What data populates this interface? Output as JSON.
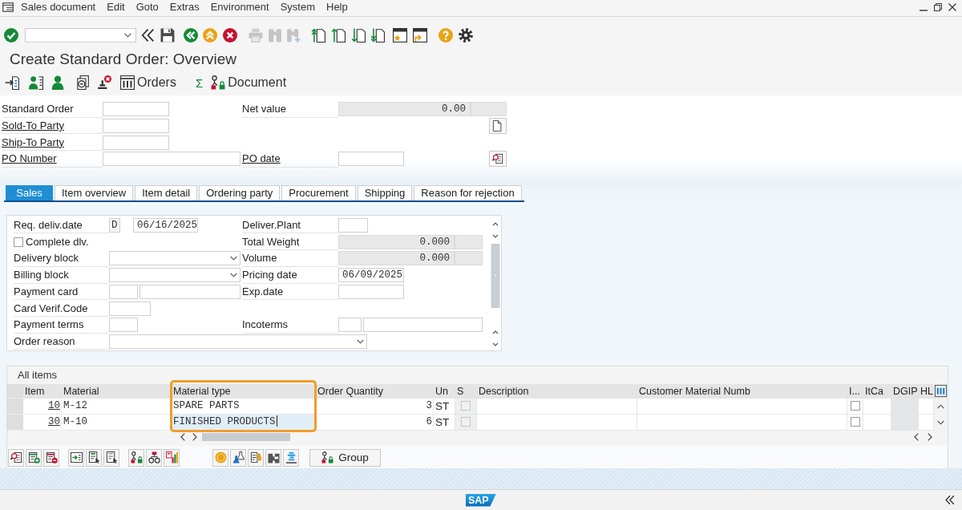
{
  "menu": [
    {
      "label": "Sales document"
    },
    {
      "label": "Edit"
    },
    {
      "label": "Goto"
    },
    {
      "label": "Extras"
    },
    {
      "label": "Environment"
    },
    {
      "label": "System"
    },
    {
      "label": "Help"
    }
  ],
  "title": "Create Standard Order: Overview",
  "app_toolbar": {
    "buttons": [
      {
        "label": "Orders"
      },
      {
        "label": "Σ"
      },
      {
        "label": "Document"
      }
    ]
  },
  "header": {
    "rows": [
      {
        "left": {
          "label": "Standard Order",
          "link": false,
          "fields": [
            {
              "kind": "input"
            }
          ]
        },
        "right": {
          "label": "Net value",
          "link": false,
          "fields": [
            {
              "kind": "display",
              "value": "0.00"
            },
            {
              "kind": "display"
            }
          ]
        }
      },
      {
        "left": {
          "label": "Sold-To Party",
          "link": true,
          "fields": [
            {
              "kind": "input"
            }
          ]
        }
      },
      {
        "left": {
          "label": "Ship-To Party",
          "link": true,
          "fields": [
            {
              "kind": "input"
            }
          ]
        }
      },
      {
        "left": {
          "label": "PO Number",
          "link": true,
          "fields": [
            {
              "kind": "input"
            }
          ]
        },
        "right": {
          "label": "PO date",
          "link": true,
          "fields": [
            {
              "kind": "input"
            }
          ]
        }
      }
    ]
  },
  "tabs": [
    {
      "label": "Sales",
      "selected": true
    },
    {
      "label": "Item overview",
      "selected": false
    },
    {
      "label": "Item detail",
      "selected": false
    },
    {
      "label": "Ordering party",
      "selected": false
    },
    {
      "label": "Procurement",
      "selected": false
    },
    {
      "label": "Shipping",
      "selected": false
    },
    {
      "label": "Reason for rejection",
      "selected": false
    }
  ],
  "sales": {
    "rows": [
      {
        "left": {
          "label": "Req. deliv.date",
          "fields": [
            {
              "kind": "input",
              "value": "D"
            },
            {
              "kind": "input",
              "value": "06/16/2025"
            }
          ]
        },
        "right": {
          "label": "Deliver.Plant",
          "fields": [
            {
              "kind": "input"
            }
          ]
        }
      },
      {
        "checkbox": {
          "label": "Complete dlv.",
          "checked": false
        },
        "right": {
          "label": "Total Weight",
          "fields": [
            {
              "kind": "display",
              "value": "0.000"
            },
            {
              "kind": "display"
            }
          ]
        }
      },
      {
        "left": {
          "label": "Delivery block",
          "fields": [
            {
              "kind": "dropdown"
            }
          ]
        },
        "right": {
          "label": "Volume",
          "fields": [
            {
              "kind": "display",
              "value": "0.000"
            },
            {
              "kind": "display"
            }
          ]
        }
      },
      {
        "left": {
          "label": "Billing block",
          "fields": [
            {
              "kind": "dropdown"
            }
          ]
        },
        "right": {
          "label": "Pricing date",
          "fields": [
            {
              "kind": "input",
              "value": "06/09/2025"
            }
          ]
        }
      },
      {
        "left": {
          "label": "Payment card",
          "fields": [
            {
              "kind": "input"
            },
            {
              "kind": "input"
            }
          ]
        },
        "right": {
          "label": "Exp.date",
          "fields": [
            {
              "kind": "input"
            }
          ]
        }
      },
      {
        "left": {
          "label": "Card Verif.Code",
          "fields": [
            {
              "kind": "input"
            }
          ]
        }
      },
      {
        "left": {
          "label": "Payment terms",
          "fields": [
            {
              "kind": "input"
            }
          ]
        },
        "right": {
          "label": "Incoterms",
          "fields": [
            {
              "kind": "input"
            },
            {
              "kind": "input"
            }
          ]
        }
      },
      {
        "left": {
          "label": "Order reason",
          "fields": [
            {
              "kind": "dropdown"
            }
          ]
        }
      }
    ]
  },
  "items": {
    "title": "All items",
    "columns": [
      {
        "label": "Item",
        "highlighted": false
      },
      {
        "label": "Material",
        "highlighted": false
      },
      {
        "label": "Material type",
        "highlighted": true
      },
      {
        "label": "Order Quantity",
        "highlighted": false
      },
      {
        "label": "Un",
        "highlighted": false
      },
      {
        "label": "S",
        "highlighted": false
      },
      {
        "label": "Description",
        "highlighted": false
      },
      {
        "label": "Customer Material Numb",
        "highlighted": false
      },
      {
        "label": "I...",
        "highlighted": false
      },
      {
        "label": "ItCa",
        "highlighted": false
      },
      {
        "label": "DGIP",
        "highlighted": false
      },
      {
        "label": "HL",
        "highlighted": false
      }
    ],
    "rows": [
      {
        "item": "10",
        "material": "M-12",
        "material_type": "SPARE PARTS",
        "focused": false,
        "quantity": "3",
        "unit": "ST",
        "s_checked": false,
        "i_checked": false
      },
      {
        "item": "30",
        "material": "M-10",
        "material_type": "FINISHED PRODUCTS",
        "focused": true,
        "quantity": "6",
        "unit": "ST",
        "s_checked": false,
        "i_checked": false
      }
    ]
  },
  "group_button": {
    "label": "Group"
  },
  "status_bar": {
    "logo": "SAP"
  }
}
